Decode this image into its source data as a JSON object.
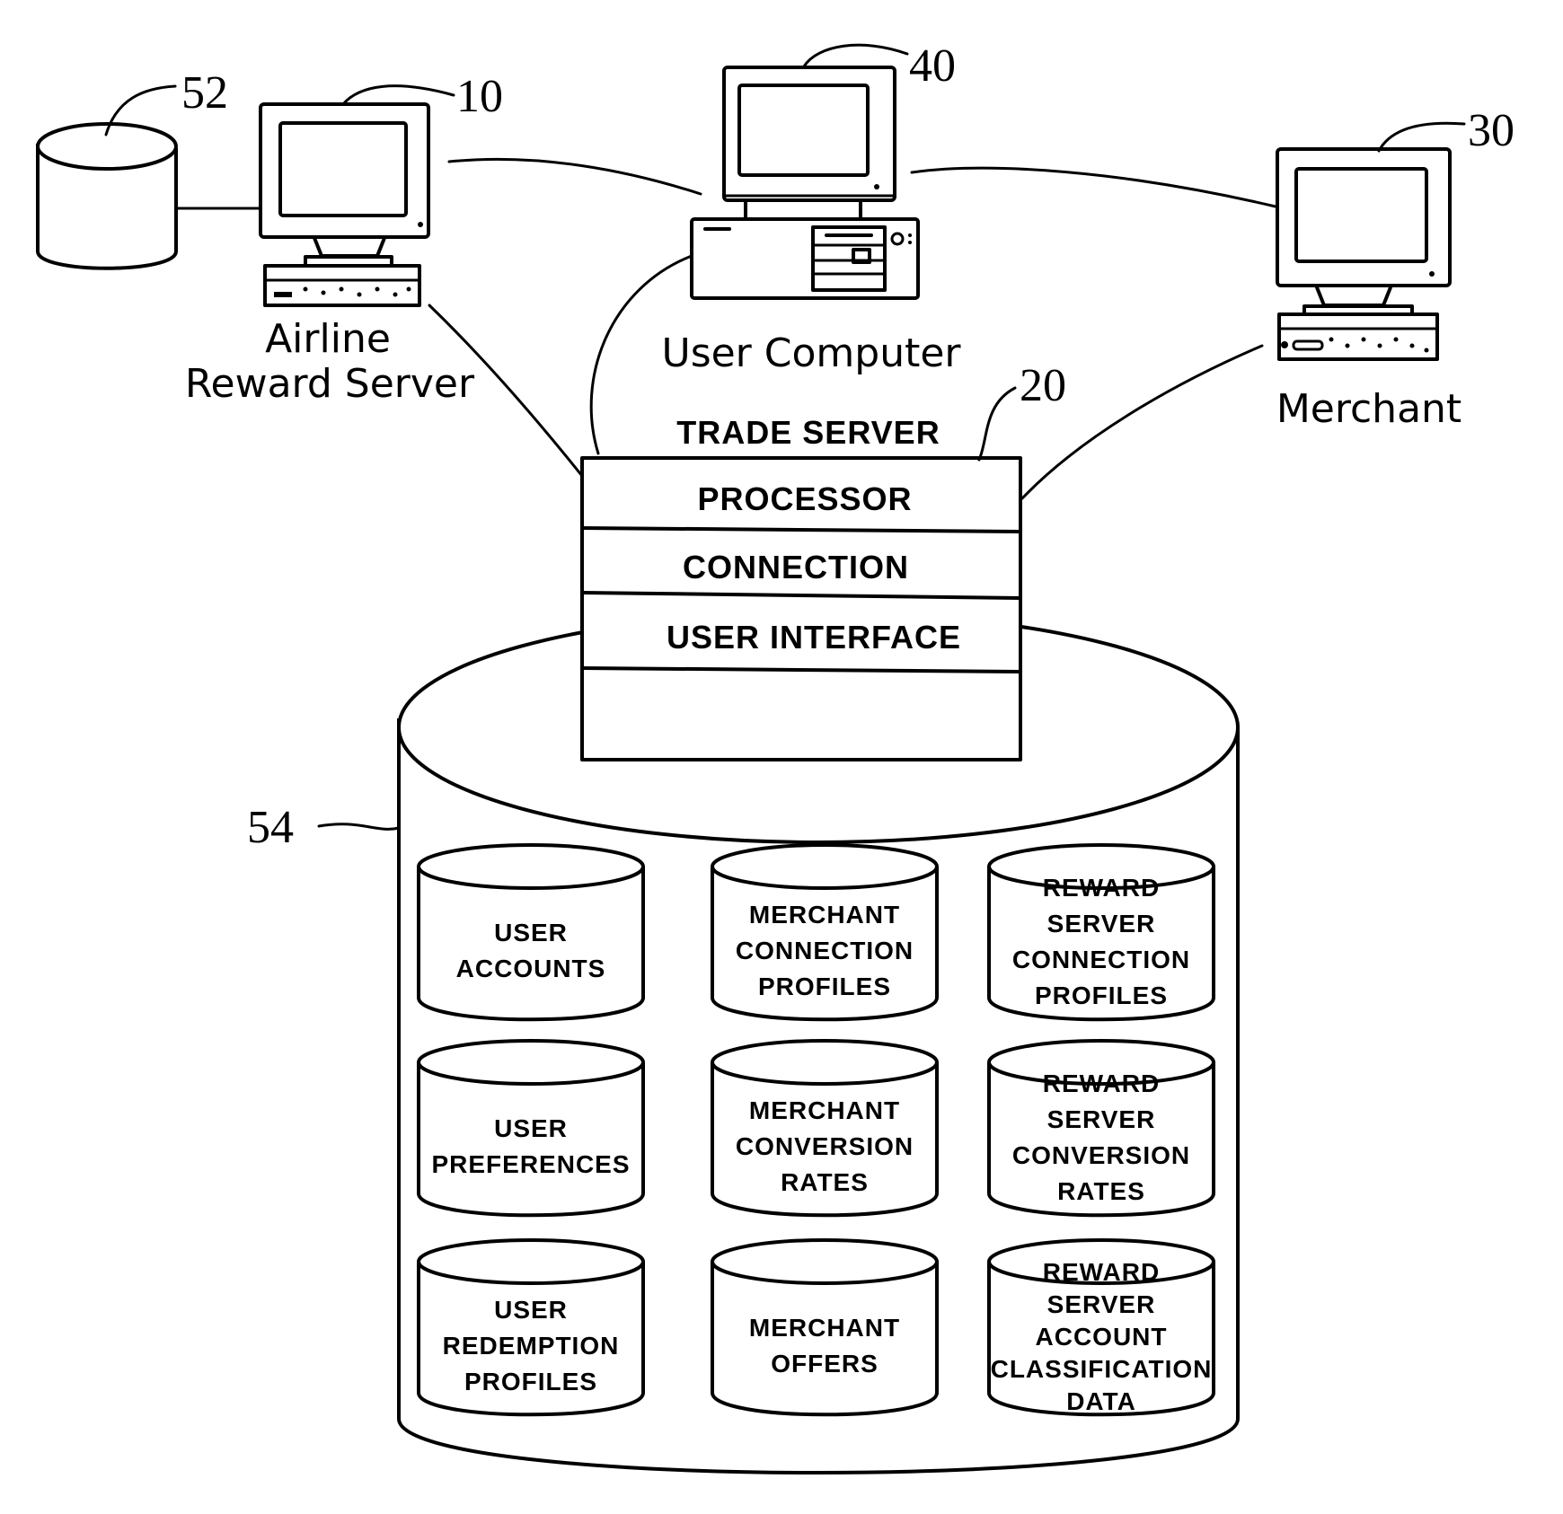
{
  "figure": {
    "nodes": {
      "airline_reward_server": {
        "ref": "10",
        "label_lines": [
          "Airline",
          "Reward Server"
        ]
      },
      "airline_database": {
        "ref": "52"
      },
      "user_computer": {
        "ref": "40",
        "label": "User Computer"
      },
      "merchant": {
        "ref": "30",
        "label": "Merchant"
      },
      "trade_server": {
        "ref": "20",
        "title": "TRADE SERVER",
        "modules": [
          "PROCESSOR",
          "CONNECTION",
          "USER INTERFACE",
          ""
        ]
      },
      "trade_database": {
        "ref": "54",
        "stores": [
          {
            "id": "user-accounts",
            "lines": [
              "USER",
              "ACCOUNTS"
            ]
          },
          {
            "id": "merchant-connection-profiles",
            "lines": [
              "MERCHANT",
              "CONNECTION",
              "PROFILES"
            ]
          },
          {
            "id": "reward-server-connection-profiles",
            "lines": [
              "REWARD",
              "SERVER",
              "CONNECTION",
              "PROFILES"
            ]
          },
          {
            "id": "user-preferences",
            "lines": [
              "USER",
              "PREFERENCES"
            ]
          },
          {
            "id": "merchant-conversion-rates",
            "lines": [
              "MERCHANT",
              "CONVERSION",
              "RATES"
            ]
          },
          {
            "id": "reward-server-conversion-rates",
            "lines": [
              "REWARD",
              "SERVER",
              "CONVERSION",
              "RATES"
            ]
          },
          {
            "id": "user-redemption-profiles",
            "lines": [
              "USER",
              "REDEMPTION",
              "PROFILES"
            ]
          },
          {
            "id": "merchant-offers",
            "lines": [
              "MERCHANT",
              "OFFERS"
            ]
          },
          {
            "id": "reward-server-account-classification-data",
            "lines": [
              "REWARD",
              "SERVER",
              "ACCOUNT",
              "CLASSIFICATION",
              "DATA"
            ]
          }
        ]
      }
    },
    "connections": [
      [
        "airline_database",
        "airline_reward_server"
      ],
      [
        "airline_reward_server",
        "user_computer"
      ],
      [
        "user_computer",
        "merchant"
      ],
      [
        "airline_reward_server",
        "trade_server"
      ],
      [
        "user_computer",
        "trade_server"
      ],
      [
        "merchant",
        "trade_server"
      ]
    ]
  }
}
